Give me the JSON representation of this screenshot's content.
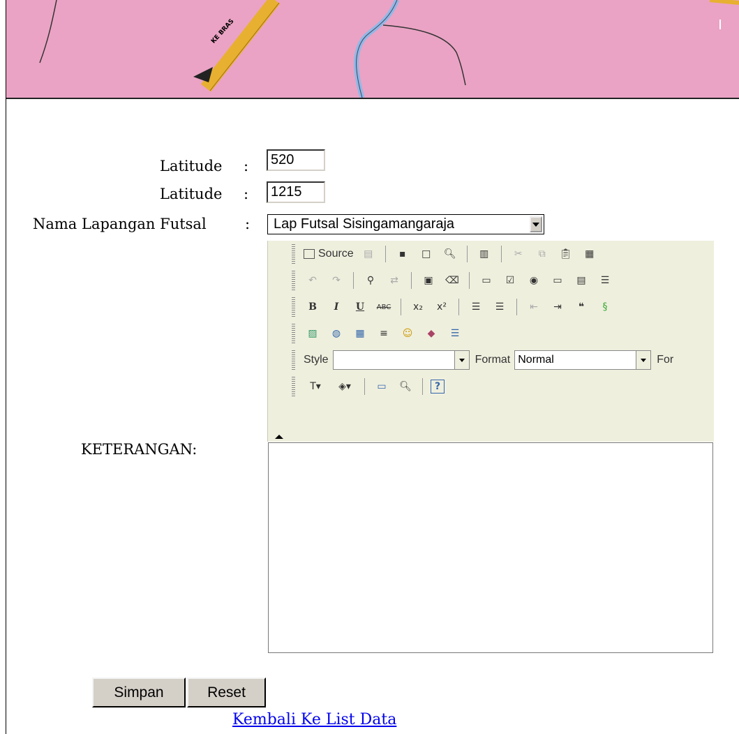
{
  "map": {
    "road_label": "KE BRAS",
    "colors": {
      "background": "#eaa3c4",
      "road": "#e8b030",
      "river": "#8fb8e8"
    }
  },
  "form": {
    "latitude_1": {
      "label": "Latitude",
      "colon": ":",
      "value": "520"
    },
    "latitude_2": {
      "label": "Latitude",
      "colon": ":",
      "value": "1215"
    },
    "nama_lapangan": {
      "label": "Nama Lapangan Futsal",
      "colon": ":",
      "selected": "Lap Futsal Sisingamangaraja"
    },
    "keterangan_label": "KETERANGAN:"
  },
  "editor": {
    "source_label": "Source",
    "style_label": "Style",
    "style_value": "",
    "format_label": "Format",
    "format_value": "Normal",
    "font_label": "For",
    "icons_row1": [
      "source-icon",
      "templates-icon",
      "save-icon",
      "new-page-icon",
      "preview-icon",
      "document-icon",
      "cut-icon",
      "copy-icon",
      "paste-icon",
      "paste-text-icon"
    ],
    "icons_row2": [
      "undo-icon",
      "redo-icon",
      "find-icon",
      "replace-icon",
      "select-all-icon",
      "remove-format-icon",
      "form-icon",
      "checkbox-icon",
      "radio-icon",
      "textfield-icon",
      "textarea-icon",
      "select-list-icon"
    ],
    "icons_row3": [
      "bold-icon",
      "italic-icon",
      "underline-icon",
      "strikethrough-icon",
      "subscript-icon",
      "superscript-icon",
      "ordered-list-icon",
      "bullet-list-icon",
      "outdent-icon",
      "indent-icon",
      "blockquote-icon",
      "div-icon"
    ],
    "icons_row4": [
      "image-icon",
      "flash-icon",
      "table-icon",
      "horizontal-rule-icon",
      "smiley-icon",
      "special-char-icon",
      "page-break-icon"
    ],
    "icons_row6": [
      "text-color-icon",
      "background-color-icon",
      "maximize-icon",
      "show-blocks-icon",
      "about-icon"
    ]
  },
  "buttons": {
    "save": "Simpan",
    "reset": "Reset"
  },
  "link": {
    "back": "Kembali Ke List Data"
  }
}
